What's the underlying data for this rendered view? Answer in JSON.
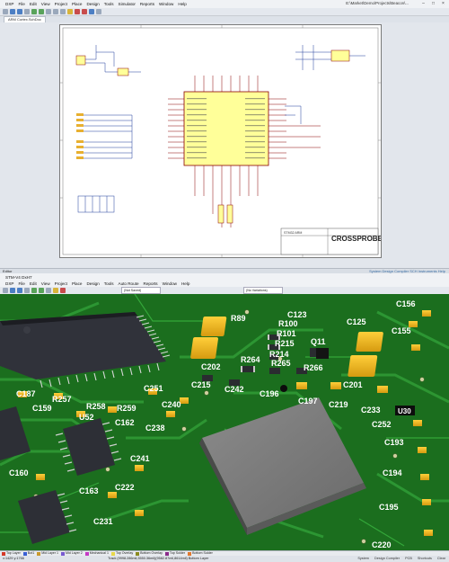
{
  "schematic_window": {
    "title": "E:\\Market\\Demo\\Projects\\Beacon\\...",
    "menu": [
      "DXP",
      "File",
      "Edit",
      "View",
      "Project",
      "Place",
      "Design",
      "Tools",
      "Simulator",
      "Reports",
      "Window",
      "Help"
    ],
    "tab_label": "ARM Cortex.SchDoc",
    "status_left": "Editor",
    "status_right": "System   Design Compiler   SCH   Instruments   Help"
  },
  "schematic": {
    "title_block_name": "CROSSPROBE",
    "title_block_title": "STM32 ARM"
  },
  "pcb_window": {
    "menu": [
      "DXP",
      "File",
      "Edit",
      "View",
      "Project",
      "Place",
      "Design",
      "Tools",
      "Auto Route",
      "Reports",
      "Window",
      "Help"
    ],
    "title_left": "STM-V4   DxH7",
    "tab_label": "ARM Cortex.PcbDoc",
    "toolbar_combo1": "(Not Saved)",
    "toolbar_combo2": "(No Variations)"
  },
  "pcb_labels": {
    "r89": "R89",
    "c123": "C123",
    "c125": "C125",
    "c156": "C156",
    "r100": "R100",
    "r101": "R101",
    "r215": "R215",
    "q11": "Q11",
    "c155": "C155",
    "r214": "R214",
    "c202": "C202",
    "r264": "R264",
    "r265": "R265",
    "r266": "R266",
    "c215": "C215",
    "c242": "C242",
    "c196": "C196",
    "c197": "C197",
    "c219": "C219",
    "c201": "C201",
    "c233": "C233",
    "u30": "U30",
    "c187": "C187",
    "r257": "R257",
    "c251": "C251",
    "c159": "C159",
    "r258": "R258",
    "r259": "R259",
    "c240": "C240",
    "c252": "C252",
    "u52": "U52",
    "c162": "C162",
    "c238": "C238",
    "c193": "C193",
    "c241": "C241",
    "c160": "C160",
    "c163": "C163",
    "c222": "C222",
    "c194": "C194",
    "c195": "C195",
    "c231": "C231",
    "c220": "C220"
  },
  "layers": [
    {
      "name": "Top Layer",
      "color": "#d43a2a"
    },
    {
      "name": "Bot1",
      "color": "#3a5fd4"
    },
    {
      "name": "Mid Layer 1",
      "color": "#c99a2e"
    },
    {
      "name": "Mid Layer 2",
      "color": "#7a5bd0"
    },
    {
      "name": "Mechanical 1",
      "color": "#c43ac4"
    },
    {
      "name": "Top Overlay",
      "color": "#e8d84a"
    },
    {
      "name": "Bottom Overlay",
      "color": "#8a8a20"
    },
    {
      "name": "Top Solder",
      "color": "#8a2a8a"
    },
    {
      "name": "Bottom Solder",
      "color": "#e07a30"
    }
  ],
  "pcb_status": {
    "left": "x:1429 y:1766",
    "mid": "Track (9998.286mil,3550.36mil)(9582.87mil,8614mil) Bottom Layer",
    "right": [
      "System",
      "Design Compiler",
      "PCB",
      "Shortcuts",
      "Clear"
    ]
  },
  "colors": {
    "board_green": "#1b6e1e",
    "copper_trace": "#2f9a35",
    "pad_gold": "#f0b419",
    "ic_body": "#30323a",
    "schematic_chip": "#ffff99"
  }
}
